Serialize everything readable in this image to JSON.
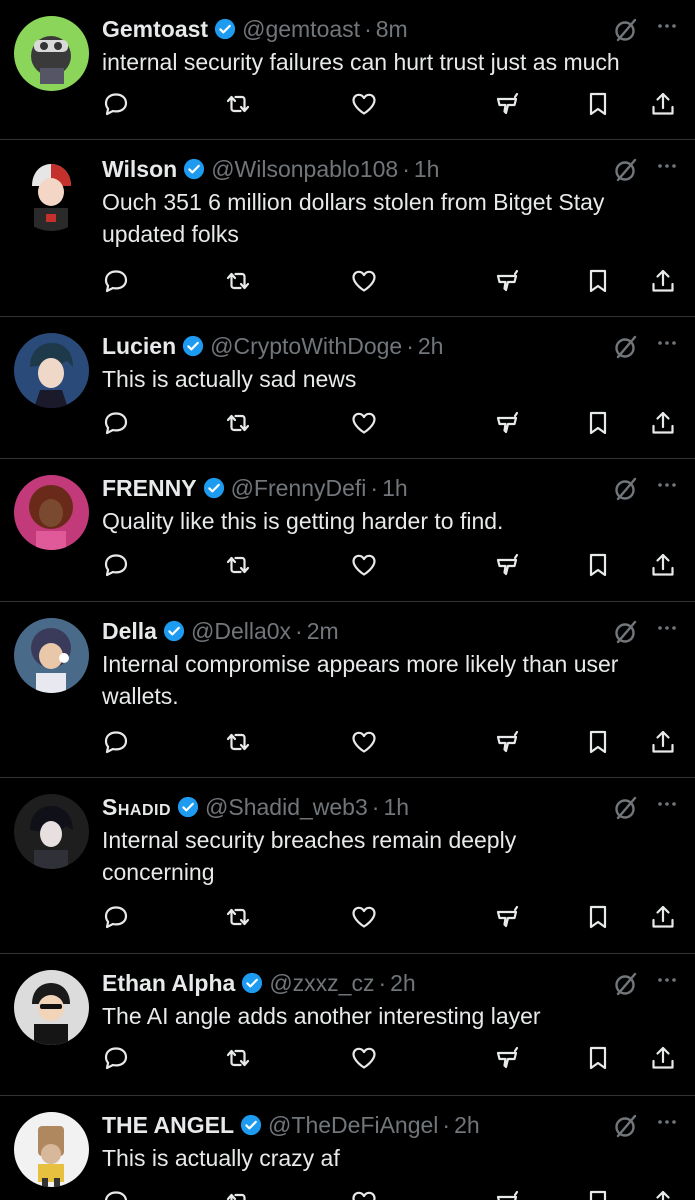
{
  "colors": {
    "background": "#000000",
    "text": "#e7e9ea",
    "muted": "#71767b",
    "verified": "#1d9bf0",
    "divider": "#2f3336"
  },
  "icons": {
    "verified": "verified-badge-icon",
    "grok": "grok-icon",
    "more": "more-options-icon",
    "reply": "reply-icon",
    "repost": "repost-icon",
    "like": "like-heart-icon",
    "stats": "analytics-icon",
    "bookmark": "bookmark-icon",
    "share": "share-icon"
  },
  "tweets": [
    {
      "name": "Gemtoast",
      "handle": "@gemtoast",
      "time": "8m",
      "text": "internal security failures can hurt trust just as much"
    },
    {
      "name": "Wilson",
      "handle": "@Wilsonpablo108",
      "time": "1h",
      "text": "Ouch 351 6 million dollars stolen from Bitget Stay updated folks"
    },
    {
      "name": "Lucien",
      "handle": "@CryptoWithDoge",
      "time": "2h",
      "text": "This is actually sad news"
    },
    {
      "name": "FRENNY",
      "handle": "@FrennyDefi",
      "time": "1h",
      "text": "Quality like this is getting harder to find."
    },
    {
      "name": "Della",
      "handle": "@Della0x",
      "time": "2m",
      "text": "Internal compromise appears more likely than user wallets."
    },
    {
      "name": "Shadid",
      "handle": "@Shadid_web3",
      "time": "1h",
      "text": "Internal security breaches remain deeply concerning"
    },
    {
      "name": "Ethan Alpha",
      "handle": "@zxxz_cz",
      "time": "2h",
      "text": "The AI angle adds another interesting layer"
    },
    {
      "name": "THE ANGEL",
      "handle": "@TheDeFiAngel",
      "time": "2h",
      "text": "This is actually crazy af"
    }
  ]
}
